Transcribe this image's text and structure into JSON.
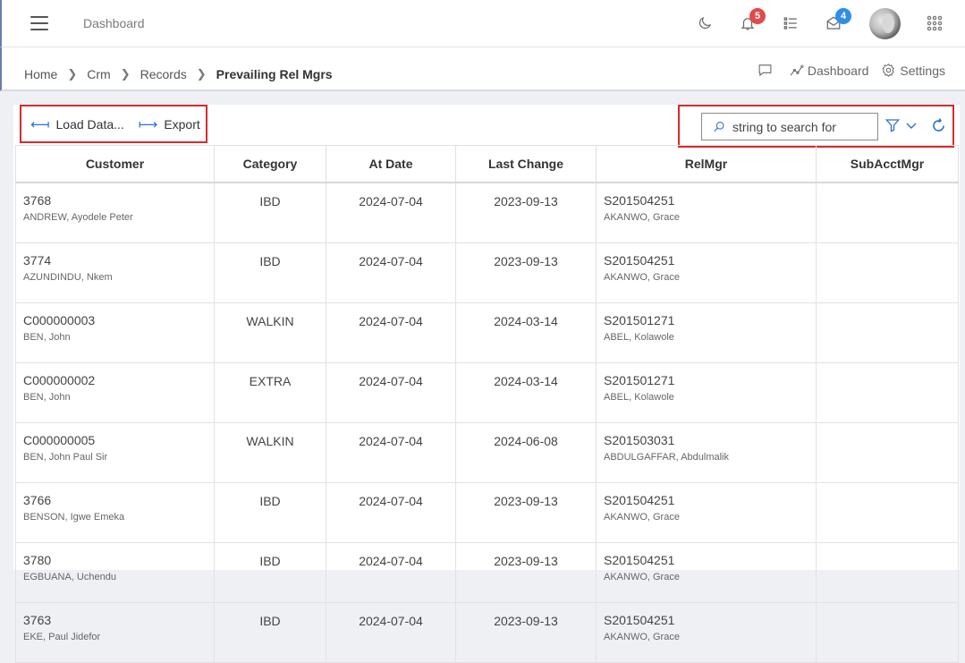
{
  "header": {
    "title": "Dashboard",
    "notifications_count": "5",
    "messages_count": "4",
    "colors": {
      "notif_badge": "#e04b4b",
      "mail_badge": "#2f8fe6",
      "accent": "#2a6fd6"
    }
  },
  "breadcrumb": {
    "items": [
      "Home",
      "Crm",
      "Records"
    ],
    "current": "Prevailing Rel Mgrs",
    "actions": {
      "dashboard": "Dashboard",
      "settings": "Settings"
    }
  },
  "toolbar": {
    "load_label": "Load Data...",
    "export_label": "Export",
    "search_placeholder": "string to search for"
  },
  "table": {
    "columns": [
      "Customer",
      "Category",
      "At Date",
      "Last Change",
      "RelMgr",
      "SubAcctMgr"
    ],
    "rows": [
      {
        "customer_id": "3768",
        "customer_name": "ANDREW, Ayodele Peter",
        "category": "IBD",
        "at_date": "2024-07-04",
        "last_change": "2023-09-13",
        "relmgr_id": "S201504251",
        "relmgr_name": "AKANWO, Grace",
        "subacctmgr": ""
      },
      {
        "customer_id": "3774",
        "customer_name": "AZUNDINDU, Nkem",
        "category": "IBD",
        "at_date": "2024-07-04",
        "last_change": "2023-09-13",
        "relmgr_id": "S201504251",
        "relmgr_name": "AKANWO, Grace",
        "subacctmgr": ""
      },
      {
        "customer_id": "C000000003",
        "customer_name": "BEN, John",
        "category": "WALKIN",
        "at_date": "2024-07-04",
        "last_change": "2024-03-14",
        "relmgr_id": "S201501271",
        "relmgr_name": "ABEL, Kolawole",
        "subacctmgr": ""
      },
      {
        "customer_id": "C000000002",
        "customer_name": "BEN, John",
        "category": "EXTRA",
        "at_date": "2024-07-04",
        "last_change": "2024-03-14",
        "relmgr_id": "S201501271",
        "relmgr_name": "ABEL, Kolawole",
        "subacctmgr": ""
      },
      {
        "customer_id": "C000000005",
        "customer_name": "BEN, John Paul Sir",
        "category": "WALKIN",
        "at_date": "2024-07-04",
        "last_change": "2024-06-08",
        "relmgr_id": "S201503031",
        "relmgr_name": "ABDULGAFFAR, Abdulmalik",
        "subacctmgr": ""
      },
      {
        "customer_id": "3766",
        "customer_name": "BENSON, Igwe Emeka",
        "category": "IBD",
        "at_date": "2024-07-04",
        "last_change": "2023-09-13",
        "relmgr_id": "S201504251",
        "relmgr_name": "AKANWO, Grace",
        "subacctmgr": ""
      },
      {
        "customer_id": "3780",
        "customer_name": "EGBUANA, Uchendu",
        "category": "IBD",
        "at_date": "2024-07-04",
        "last_change": "2023-09-13",
        "relmgr_id": "S201504251",
        "relmgr_name": "AKANWO, Grace",
        "subacctmgr": ""
      },
      {
        "customer_id": "3763",
        "customer_name": "EKE, Paul Jidefor",
        "category": "IBD",
        "at_date": "2024-07-04",
        "last_change": "2023-09-13",
        "relmgr_id": "S201504251",
        "relmgr_name": "AKANWO, Grace",
        "subacctmgr": ""
      }
    ]
  }
}
